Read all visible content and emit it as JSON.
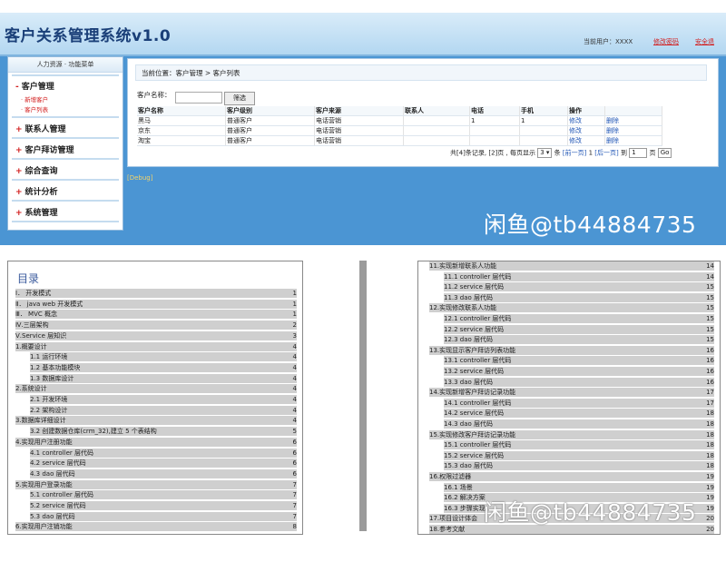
{
  "app": {
    "title": "客户关系管理系统v1.0",
    "current_user": "当前用户：XXXX",
    "change_password": "修改密码",
    "logout": "安全退",
    "sidebar": {
      "header": "人力资源 · 功能菜单",
      "sections": [
        "客户管理",
        "联系人管理",
        "客户拜访管理",
        "综合查询",
        "统计分析",
        "系统管理"
      ],
      "section_prefix": [
        "-",
        "+",
        "+",
        "+",
        "+",
        "+"
      ],
      "sub_items": [
        "新增客户",
        "客户列表"
      ]
    },
    "breadcrumb": {
      "label": "当前位置：",
      "path": "客户管理 > 客户列表"
    },
    "search": {
      "label": "客户名称：",
      "value": "",
      "button": "筛选"
    },
    "table": {
      "headers": [
        "客户名称",
        "客户级别",
        "客户来源",
        "联系人",
        "电话",
        "手机",
        "操作",
        ""
      ],
      "rows": [
        [
          "黑马",
          "普通客户",
          "电话营销",
          "",
          "1",
          "1",
          "修改",
          "删除"
        ],
        [
          "京东",
          "普通客户",
          "电话营销",
          "",
          "",
          "",
          "修改",
          "删除"
        ],
        [
          "淘宝",
          "普通客户",
          "电话营销",
          "",
          "",
          "",
          "修改",
          "删除"
        ]
      ]
    },
    "pager": {
      "total_text": "共[4]条记录, [2]页 , 每页显示",
      "page_size": "3 ▾",
      "unit": "条",
      "prev": "[前一页]",
      "current": "1",
      "next": "[后一页]",
      "goto_label": "到",
      "goto_value": "1",
      "page_label": "页",
      "go_button": "Go"
    },
    "debug": "[Debug]"
  },
  "watermark": "闲鱼@tb44884735",
  "doc": {
    "toc_title": "目录",
    "left_lines": [
      {
        "text": "Ⅰ． 开发模式",
        "page": "1",
        "indent": 0
      },
      {
        "text": "Ⅱ． java web 开发模式",
        "page": "1",
        "indent": 0
      },
      {
        "text": "Ⅲ． MVC 概念",
        "page": "1",
        "indent": 0
      },
      {
        "text": "Ⅳ.三层架构",
        "page": "2",
        "indent": 0
      },
      {
        "text": "Ⅴ.Service 层知识",
        "page": "3",
        "indent": 0
      },
      {
        "text": "1.概要设计",
        "page": "4",
        "indent": 0
      },
      {
        "text": "1.1 运行环境",
        "page": "4",
        "indent": 1
      },
      {
        "text": "1.2 基本功能模块",
        "page": "4",
        "indent": 1
      },
      {
        "text": "1.3 数据库设计",
        "page": "4",
        "indent": 1
      },
      {
        "text": "2.系统设计",
        "page": "4",
        "indent": 0
      },
      {
        "text": "2.1 开发环境",
        "page": "4",
        "indent": 1
      },
      {
        "text": "2.2 架构设计",
        "page": "4",
        "indent": 1
      },
      {
        "text": "3.数据库详细设计",
        "page": "4",
        "indent": 0
      },
      {
        "text": "3.2 创建数据仓库(crm_32),建立 5 个表结构",
        "page": "5",
        "indent": 1
      },
      {
        "text": "4.实现用户注册功能",
        "page": "6",
        "indent": 0
      },
      {
        "text": "4.1 controller 层代码",
        "page": "6",
        "indent": 1
      },
      {
        "text": "4.2 service 层代码",
        "page": "6",
        "indent": 1
      },
      {
        "text": "4.3 dao 层代码",
        "page": "6",
        "indent": 1
      },
      {
        "text": "5.实现用户登录功能",
        "page": "7",
        "indent": 0
      },
      {
        "text": "5.1 controller 层代码",
        "page": "7",
        "indent": 1
      },
      {
        "text": "5.2 service 层代码",
        "page": "7",
        "indent": 1
      },
      {
        "text": "5.3 dao 层代码",
        "page": "7",
        "indent": 1
      },
      {
        "text": "6.实现用户注销功能",
        "page": "8",
        "indent": 0
      }
    ],
    "right_lines": [
      {
        "text": "11.实现新增联系人功能",
        "page": "14",
        "indent": 0
      },
      {
        "text": "11.1 controller 层代码",
        "page": "14",
        "indent": 1
      },
      {
        "text": "11.2 service 层代码",
        "page": "15",
        "indent": 1
      },
      {
        "text": "11.3 dao 层代码",
        "page": "15",
        "indent": 1
      },
      {
        "text": "12.实现修改联系人功能",
        "page": "15",
        "indent": 0
      },
      {
        "text": "12.1 controller 层代码",
        "page": "15",
        "indent": 1
      },
      {
        "text": "12.2 service 层代码",
        "page": "15",
        "indent": 1
      },
      {
        "text": "12.3 dao 层代码",
        "page": "15",
        "indent": 1
      },
      {
        "text": "13.实现显示客户拜访列表功能",
        "page": "16",
        "indent": 0
      },
      {
        "text": "13.1 controller 层代码",
        "page": "16",
        "indent": 1
      },
      {
        "text": "13.2 service 层代码",
        "page": "16",
        "indent": 1
      },
      {
        "text": "13.3 dao 层代码",
        "page": "16",
        "indent": 1
      },
      {
        "text": "14.实现新增客户拜访记录功能",
        "page": "17",
        "indent": 0
      },
      {
        "text": "14.1 controller 层代码",
        "page": "17",
        "indent": 1
      },
      {
        "text": "14.2 service 层代码",
        "page": "18",
        "indent": 1
      },
      {
        "text": "14.3 dao 层代码",
        "page": "18",
        "indent": 1
      },
      {
        "text": "15.实现修改客户拜访记录功能",
        "page": "18",
        "indent": 0
      },
      {
        "text": "15.1 controller 层代码",
        "page": "18",
        "indent": 1
      },
      {
        "text": "15.2 service 层代码",
        "page": "18",
        "indent": 1
      },
      {
        "text": "15.3 dao 层代码",
        "page": "18",
        "indent": 1
      },
      {
        "text": "16.权限过滤器",
        "page": "19",
        "indent": 0
      },
      {
        "text": "16.1 场景",
        "page": "19",
        "indent": 1
      },
      {
        "text": "16.2 解决方案",
        "page": "19",
        "indent": 1
      },
      {
        "text": "16.3 步骤实现",
        "page": "19",
        "indent": 1
      },
      {
        "text": "17.项目设计体会",
        "page": "20",
        "indent": 0
      },
      {
        "text": "18.参考文献",
        "page": "20",
        "indent": 0
      }
    ]
  },
  "colors": {
    "header_title": "#1a3f78",
    "app_background": "#4b95d3",
    "accent_red": "#d21c1c",
    "link_blue": "#1f55b5"
  }
}
